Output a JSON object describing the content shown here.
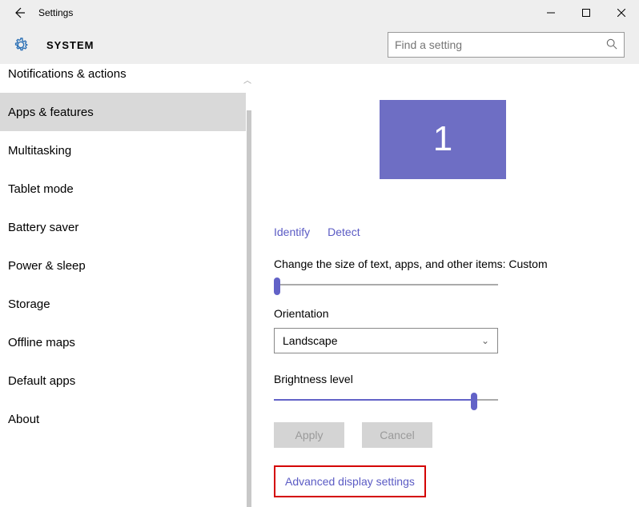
{
  "window": {
    "title": "Settings"
  },
  "header": {
    "title": "SYSTEM",
    "search_placeholder": "Find a setting"
  },
  "sidebar": {
    "items": [
      {
        "label": "Notifications & actions"
      },
      {
        "label": "Apps & features"
      },
      {
        "label": "Multitasking"
      },
      {
        "label": "Tablet mode"
      },
      {
        "label": "Battery saver"
      },
      {
        "label": "Power & sleep"
      },
      {
        "label": "Storage"
      },
      {
        "label": "Offline maps"
      },
      {
        "label": "Default apps"
      },
      {
        "label": "About"
      }
    ],
    "selected_index": 1
  },
  "display": {
    "monitor_label": "1",
    "identify_label": "Identify",
    "detect_label": "Detect",
    "scale_label": "Change the size of text, apps, and other items: Custom",
    "orientation_label": "Orientation",
    "orientation_value": "Landscape",
    "brightness_label": "Brightness level",
    "apply_label": "Apply",
    "cancel_label": "Cancel",
    "advanced_label": "Advanced display settings"
  }
}
